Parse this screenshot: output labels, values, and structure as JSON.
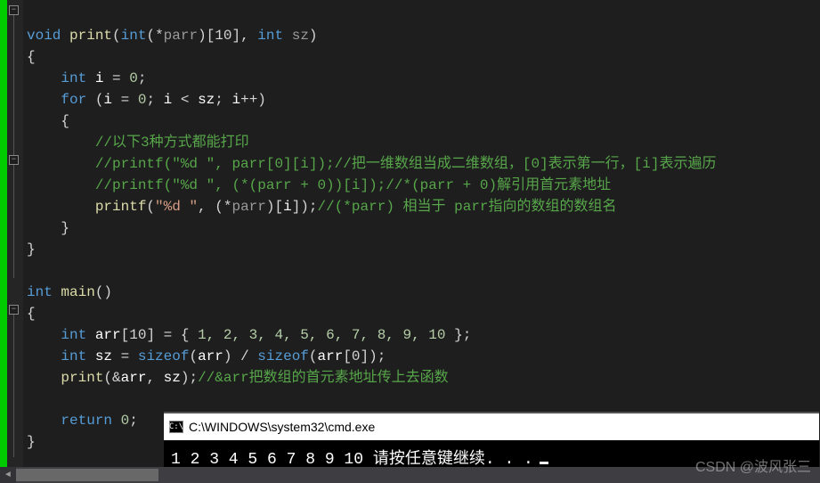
{
  "code": {
    "l1": {
      "kw_void": "void",
      "fn": "print",
      "kw_int": "int",
      "star": "*",
      "p": "parr",
      "arr": "[10]",
      "comma": ", ",
      "int2": "int",
      "sz": "sz"
    },
    "l3": {
      "kw_int": "int",
      "i": "i",
      "eq": " = ",
      "z": "0",
      "sc": ";"
    },
    "l4": {
      "for": "for",
      "open": " (",
      "i1": "i",
      "eq": " = ",
      "z": "0",
      "sc1": "; ",
      "i2": "i",
      "lt": " < ",
      "sz": "sz",
      "sc2": "; ",
      "i3": "i",
      "pp": "++",
      ")": ")"
    },
    "l6c": "//以下3种方式都能打印",
    "l7": {
      "c1": "//printf(\"%d \", parr[0][i]);",
      "c2": "//把一维数组当成二维数组，[0]表示第一行，[i]表示遍历"
    },
    "l8": {
      "c1": "//printf(\"%d \", (*(parr + 0))[i]);",
      "c2": "//*(parr + 0)解引用首元素地址"
    },
    "l9": {
      "fn": "printf",
      "s": "\"%d \"",
      "star": "*",
      "p": "parr",
      "i": "i",
      "c": "//(*parr) 相当于 parr指向的数组的数组名"
    },
    "l13": {
      "kw_int": "int",
      "fn": "main"
    },
    "l15": {
      "kw_int": "int",
      "arr": "arr",
      "dim": "[10]",
      "eq": " = { ",
      "nums": "1, 2, 3, 4, 5, 6, 7, 8, 9, 10",
      "end": " };"
    },
    "l16": {
      "kw_int": "int",
      "sz": "sz",
      "eq": " = ",
      "so1": "sizeof",
      "a1": "arr",
      "div": " / ",
      "so2": "sizeof",
      "a2": "arr",
      "idx": "[0]",
      ");": ");"
    },
    "l17": {
      "fn": "print",
      "amp": "&",
      "arr": "arr",
      "comma": ", ",
      "sz": "sz",
      "close": ");",
      "c": "//&arr把数组的首元素地址传上去函数"
    },
    "l19": {
      "ret": "return",
      "z": "0",
      "sc": ";"
    }
  },
  "console": {
    "title": "C:\\WINDOWS\\system32\\cmd.exe",
    "icon": "C:\\",
    "output": "1 2 3 4 5 6 7 8 9 10 请按任意键继续. . ."
  },
  "watermark": "CSDN @波风张三"
}
